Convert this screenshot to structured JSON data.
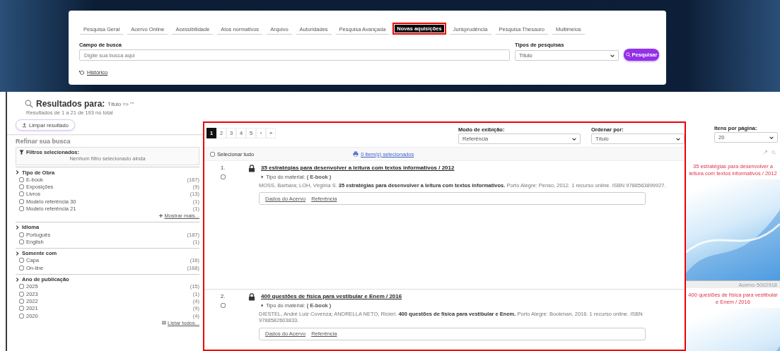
{
  "tabs": [
    {
      "label": "Pesquisa Geral",
      "selected": false,
      "highlighted": false
    },
    {
      "label": "Acervo Online",
      "selected": false,
      "highlighted": false
    },
    {
      "label": "Acessibilidade",
      "selected": false,
      "highlighted": false
    },
    {
      "label": "Atos normativos",
      "selected": false,
      "highlighted": false
    },
    {
      "label": "Arquivo",
      "selected": false,
      "highlighted": false
    },
    {
      "label": "Autoridades",
      "selected": false,
      "highlighted": false
    },
    {
      "label": "Pesquisa Avançada",
      "selected": false,
      "highlighted": false
    },
    {
      "label": "Novas aquisições",
      "selected": true,
      "highlighted": true
    },
    {
      "label": "Jurisprudência",
      "selected": false,
      "highlighted": false
    },
    {
      "label": "Pesquisa Thesauro",
      "selected": false,
      "highlighted": false
    },
    {
      "label": "Multimeios",
      "selected": false,
      "highlighted": false
    }
  ],
  "search": {
    "label": "Campo de busca",
    "placeholder": "Digite sua busca aqui"
  },
  "search_type": {
    "label": "Tipos de pesquisas",
    "value": "Título"
  },
  "search_button": "Pesquisar",
  "history_link": "Histórico",
  "results_heading": {
    "title": "Resultados para:",
    "query": "Título => \"\"",
    "count": "Resultados de 1 a 21 de 193 no total"
  },
  "clear_button": "Limpar resultado",
  "refine": {
    "title": "Refinar sua busca",
    "filters_label": "Filtros selecionados:",
    "filters_empty": "Nenhum filtro selecionado ainda"
  },
  "facets": [
    {
      "title": "Tipo de Obra",
      "items": [
        {
          "label": "E-book",
          "count": "(167)",
          "checked": false
        },
        {
          "label": "Exposições",
          "count": "(9)",
          "checked": false
        },
        {
          "label": "Livros",
          "count": "(13)",
          "checked": false
        },
        {
          "label": "Modelo referência 30",
          "count": "(1)",
          "checked": false
        },
        {
          "label": "Modelo referência 21",
          "count": "(1)",
          "checked": false
        }
      ],
      "more": {
        "kind": "more",
        "label": "Mostrar mais..."
      }
    },
    {
      "title": "Idioma",
      "items": [
        {
          "label": "Português",
          "count": "(187)",
          "checked": false
        },
        {
          "label": "English",
          "count": "(1)",
          "checked": false
        }
      ]
    },
    {
      "title": "Somente com",
      "items": [
        {
          "label": "Capa",
          "count": "(16)",
          "checked": false
        },
        {
          "label": "On-line",
          "count": "(168)",
          "checked": false
        }
      ]
    },
    {
      "title": "Ano de publicação",
      "items": [
        {
          "label": "2025",
          "count": "(15)",
          "checked": false
        },
        {
          "label": "2023",
          "count": "(1)",
          "checked": false
        },
        {
          "label": "2022",
          "count": "(4)",
          "checked": false
        },
        {
          "label": "2021",
          "count": "(9)",
          "checked": false
        },
        {
          "label": "2020",
          "count": "(4)",
          "checked": false
        }
      ],
      "more": {
        "kind": "list",
        "label": "Listar todos..."
      }
    }
  ],
  "results_panel": {
    "highlighted": true
  },
  "pagination": {
    "pages": [
      {
        "label": "1",
        "selected": true
      },
      {
        "label": "2",
        "selected": false
      },
      {
        "label": "3",
        "selected": false
      },
      {
        "label": "4",
        "selected": false
      },
      {
        "label": "5",
        "selected": false
      }
    ],
    "next": "›",
    "last": "»"
  },
  "view_mode": {
    "label": "Modo de exibição:",
    "value": "Referência"
  },
  "sort": {
    "label": "Ordenar por:",
    "value": "Título"
  },
  "per_page": {
    "label": "Itens por página:",
    "value": "20"
  },
  "select_all": {
    "label": "Selecionar tudo",
    "checked": false
  },
  "selected_count": "0 item(s) selecionados",
  "results": [
    {
      "number": "1.",
      "checked": false,
      "title": "35 estratégias para desenvolver a leitura com textos informativos / 2012",
      "material": "Tipo do material: **( E-book )**",
      "reference": "MOSS, Barbara; LOH, Virginia S. **35 estratégias para desenvolver a leitura com textos informativos.** Porto Alegre: Penso, 2012. 1 recurso online. ISBN 9788563899927.",
      "links": [
        "Dados do Acervo",
        "Referência"
      ],
      "cover": {
        "title": "35 estratégias para desenvolver a leitura com textos informativos / 2012",
        "caption": "Acervo 5002918"
      }
    },
    {
      "number": "2.",
      "checked": false,
      "title": "400 questões de física para vestibular e Enem / 2016",
      "material": "Tipo do material: **( E-book )**",
      "reference": "DIESTEL, André Luiz Covenza; ANDRELLA NETO, Ricieri. **400 questões de física para vestibular e Enem.** Porto Alegre: Bookman, 2016. 1 recurso online. ISBN 9788582603833.",
      "links": [
        "Dados do Acervo",
        "Referência"
      ],
      "cover": {
        "title": "400 questões de física para vestibular e Enem / 2016"
      }
    }
  ]
}
